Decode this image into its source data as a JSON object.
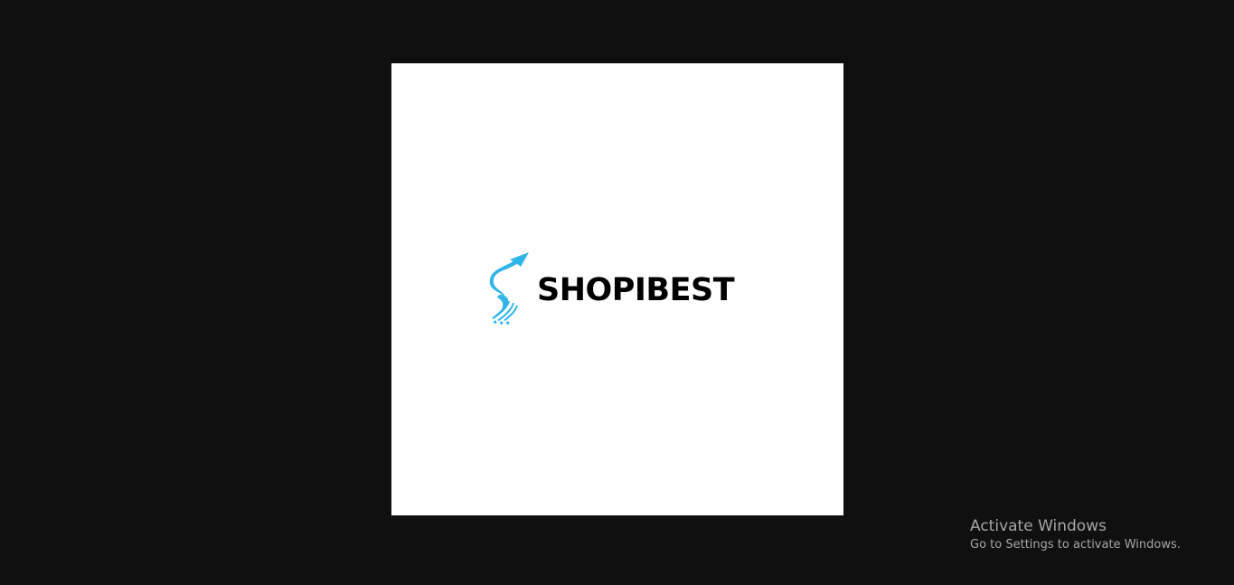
{
  "logo": {
    "brand_name": "SHOPIBEST",
    "mark_icon": "swoosh-arrow-s-icon",
    "accent_color": "#2fb5e8",
    "text_color": "#000000"
  },
  "watermark": {
    "title": "Activate Windows",
    "subtitle": "Go to Settings to activate Windows."
  },
  "colors": {
    "background": "#101010",
    "frame": "#ffffff"
  }
}
